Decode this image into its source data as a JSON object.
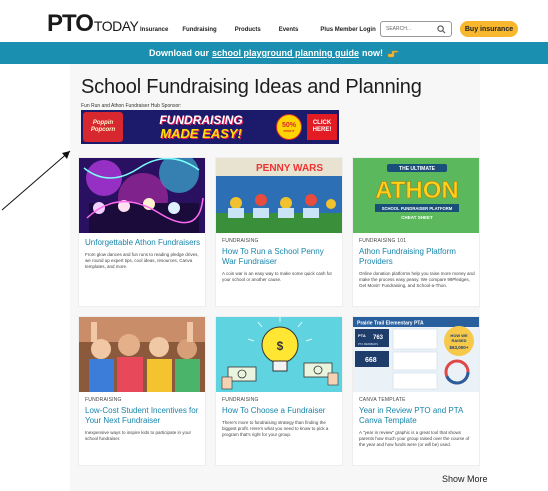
{
  "header": {
    "logo_pto": "PTO",
    "logo_today": "TODAY",
    "nav": [
      "Insurance",
      "Fundraising",
      "Products",
      "Events",
      "Plus Member Login"
    ],
    "search_placeholder": "SEARCH...",
    "buy_label": "Buy insurance"
  },
  "promo": {
    "prefix": "Download our",
    "link": "school playground planning guide",
    "suffix": "now!",
    "icon": "pointing-hand-icon"
  },
  "main": {
    "title": "School Fundraising Ideas and Planning",
    "sponsor_label": "Fun Run and Athon Fundraiser Hub Sponsor:",
    "ad": {
      "brand_l1": "Poppin",
      "brand_l2": "Popcorn",
      "headline_l1": "FUNDRAISING",
      "headline_l2": "MADE EASY!",
      "badge_pct": "50%",
      "badge_sub": "PROFIT",
      "cta_l1": "CLICK",
      "cta_l2": "HERE!"
    },
    "cards": [
      {
        "category": "",
        "title": "Unforgettable Athon Fundraisers",
        "desc": "From glow dances and fun runs to reading pledge drives, we round up expert tips, cool ideas, resources, Canva templates, and more."
      },
      {
        "category": "FUNDRAISING",
        "title": "How To Run a School Penny War Fundraiser",
        "desc": "A coin war is an easy way to make some quick cash for your school or another cause."
      },
      {
        "category": "FUNDRAISING 101",
        "title": "Athon Fundraising Platform Providers",
        "desc": "Online donation platforms help you raise more money and make the process easy peasy. We compare 99Pledges, Get Movin' Fundraising, and School-a-Thon."
      },
      {
        "category": "FUNDRAISING",
        "title": "Low-Cost Student Incentives for Your Next Fundraiser",
        "desc": "Inexpensive ways to inspire kids to participate in your school fundraiser."
      },
      {
        "category": "FUNDRAISING",
        "title": "How To Choose a Fundraiser",
        "desc": "There's more to fundraising strategy than finding the biggest profit. Here's what you need to know to pick a program that's right for your group."
      },
      {
        "category": "CANVA TEMPLATE",
        "title": "Year in Review PTO and PTA Canva Template",
        "desc": "A \"year in review\" graphic is a great tool that shows parents how much your group raised over the course of the year and how funds were (or will be) used."
      }
    ],
    "card3_img": {
      "top": "THE ULTIMATE",
      "big": "ATHON",
      "sub": "SCHOOL FUNDRAISER PLATFORM",
      "sub2": "CHEAT SHEET"
    },
    "card2_img": {
      "sign": "PENNY WARS"
    },
    "card6_img": {
      "school": "Prairie Trail Elementary PTA",
      "raised_l1": "HOW WE",
      "raised_l2": "RAISED",
      "raised_amt": "$63,000+",
      "members": "763",
      "members_label": "PTA MEMBERS",
      "volunteers": "668",
      "pta_label": "PTA"
    },
    "show_more": "Show More"
  },
  "colors": {
    "accent_teal": "#1a8faf",
    "link_blue": "#1785ac",
    "buy_yellow": "#f8b72c"
  }
}
